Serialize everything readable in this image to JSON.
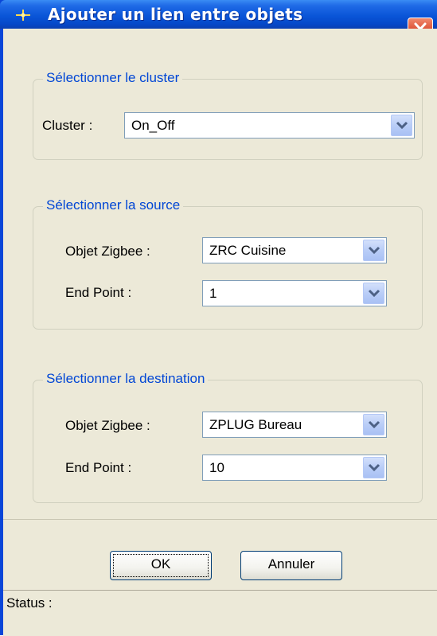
{
  "window": {
    "title": "Ajouter un lien entre objets",
    "icon": "sparkle-icon",
    "close_icon": "close-icon"
  },
  "cluster_group": {
    "legend": "Sélectionner le cluster",
    "cluster_label": "Cluster :",
    "cluster_value": "On_Off"
  },
  "source_group": {
    "legend": "Sélectionner la source",
    "object_label": "Objet Zigbee :",
    "object_value": "ZRC Cuisine",
    "endpoint_label": "End Point :",
    "endpoint_value": "1"
  },
  "destination_group": {
    "legend": "Sélectionner la destination",
    "object_label": "Objet Zigbee :",
    "object_value": "ZPLUG Bureau",
    "endpoint_label": "End Point :",
    "endpoint_value": "10"
  },
  "buttons": {
    "ok_label": "OK",
    "cancel_label": "Annuler"
  },
  "status": {
    "label": "Status :"
  },
  "colors": {
    "titlebar": "#0a55d8",
    "legend_text": "#0046d5",
    "dialog_bg": "#ece9d8",
    "close_button": "#d9472b"
  }
}
